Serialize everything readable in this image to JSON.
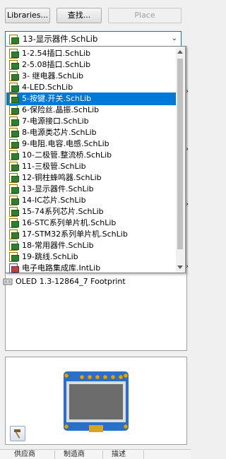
{
  "toolbar": {
    "libraries_label": "Libraries...",
    "search_label": "查找...",
    "place_label": "Place"
  },
  "library_combo": {
    "selected": "13-显示器件.SchLib"
  },
  "dropdown": {
    "items": [
      {
        "label": "1-2.54插口.SchLib",
        "icon": "schlib-icon"
      },
      {
        "label": "2-5.08插口.SchLib",
        "icon": "schlib-icon"
      },
      {
        "label": "3- 继电器.SchLib",
        "icon": "schlib-icon"
      },
      {
        "label": "4-LED.SchLib",
        "icon": "schlib-icon"
      },
      {
        "label": "5-按键.开关.SchLib",
        "icon": "schlib-icon",
        "selected": true
      },
      {
        "label": "6-保险丝.晶振.SchLib",
        "icon": "schlib-icon"
      },
      {
        "label": "7-电源接口.SchLib",
        "icon": "schlib-icon"
      },
      {
        "label": "8-电源类芯片.SchLib",
        "icon": "schlib-icon"
      },
      {
        "label": "9-电阻.电容.电感.SchLib",
        "icon": "schlib-icon"
      },
      {
        "label": "10-二极管.整流桥.SchLib",
        "icon": "schlib-icon"
      },
      {
        "label": "11-三极管.SchLib",
        "icon": "schlib-icon"
      },
      {
        "label": "12-铜柱蜂鸣器.SchLib",
        "icon": "schlib-icon"
      },
      {
        "label": "13-显示器件.SchLib",
        "icon": "schlib-icon"
      },
      {
        "label": "14-IC芯片.SchLib",
        "icon": "schlib-icon"
      },
      {
        "label": "15-74系列芯片.SchLib",
        "icon": "schlib-icon"
      },
      {
        "label": "16-STC系列单片机.SchLib",
        "icon": "schlib-icon"
      },
      {
        "label": "17-STM32系列单片机.SchLib",
        "icon": "schlib-icon"
      },
      {
        "label": "18-常用器件.SchLib",
        "icon": "schlib-icon"
      },
      {
        "label": "19-跳线.SchLib",
        "icon": "schlib-icon"
      },
      {
        "label": "电子电路集成库.IntLib",
        "icon": "intlib-icon"
      }
    ]
  },
  "footprint": {
    "label": "OLED 1.3-12864_7 Footprint"
  },
  "table": {
    "columns": [
      "供应商",
      "制造商",
      "描述"
    ]
  },
  "colors": {
    "selection": "#0078d7",
    "pcb_blue": "#2a6fc9",
    "pin_gold": "#d9a520"
  }
}
